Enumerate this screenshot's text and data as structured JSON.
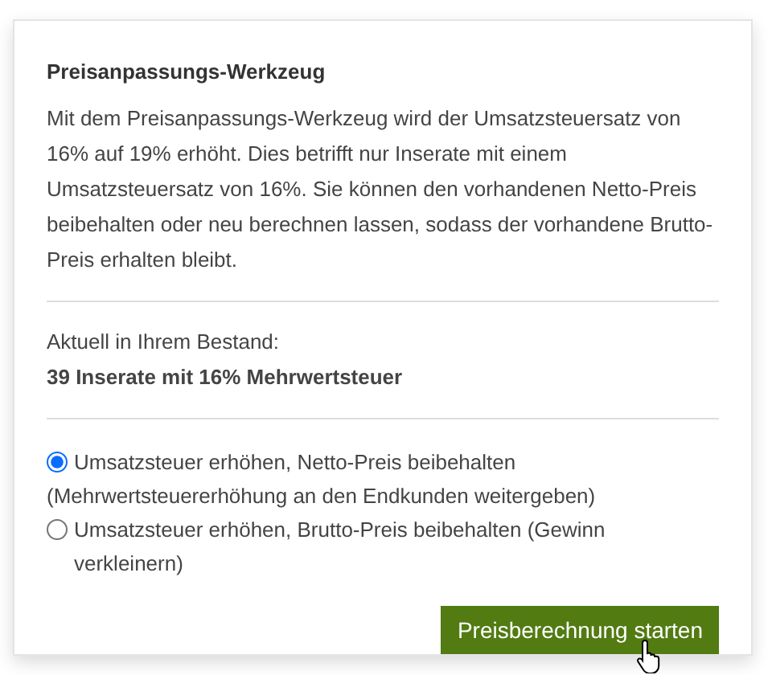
{
  "panel": {
    "title": "Preisanpassungs-Werkzeug",
    "description": "Mit dem Preisanpassungs-Werkzeug wird der Umsatzsteuersatz von 16% auf 19% erhöht. Dies betrifft nur Inserate mit einem Umsatzsteuersatz von 16%. Sie können den vorhandenen Netto-Preis beibehalten oder neu berechnen lassen, sodass der vorhandene Brutto-Preis erhalten bleibt.",
    "stock_label": "Aktuell in Ihrem Bestand:",
    "stock_value": "39 Inserate mit 16% Mehrwertsteuer",
    "options": [
      {
        "label": "Umsatzsteuer erhöhen, Netto-Preis beibehalten",
        "note": "(Mehrwertsteuererhöhung an den Endkunden weitergeben)",
        "selected": true
      },
      {
        "label": "Umsatzsteuer erhöhen, Brutto-Preis beibehalten (Gewinn verkleinern)",
        "selected": false
      }
    ],
    "button": "Preisberechnung starten"
  }
}
